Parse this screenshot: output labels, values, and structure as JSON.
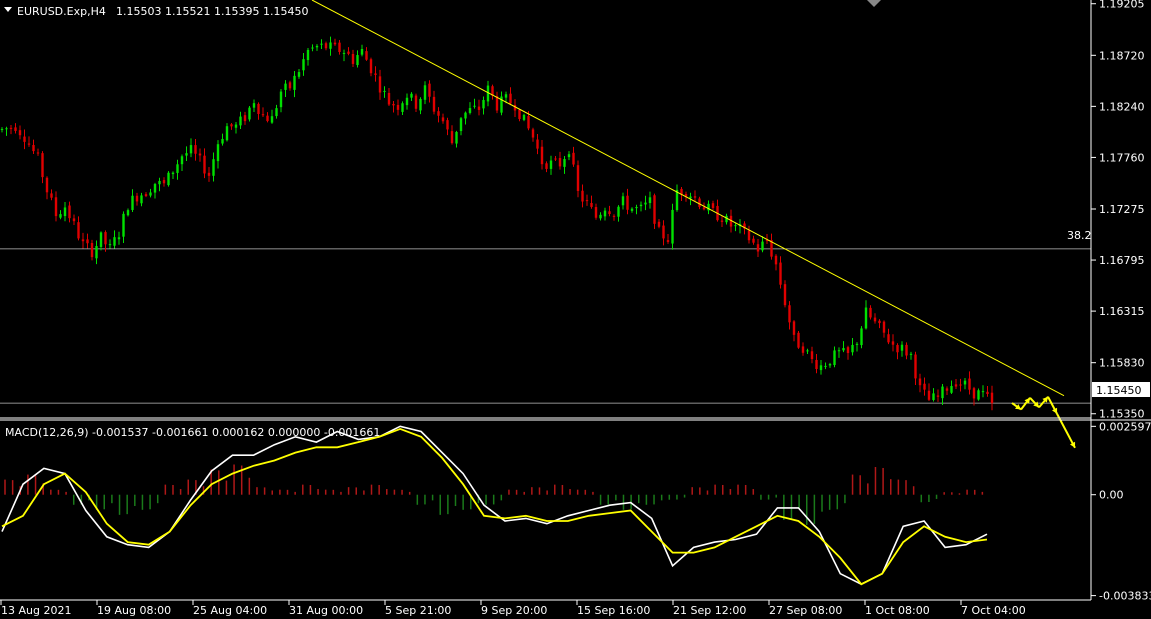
{
  "header": {
    "symbol": "EURUSD.Exp,H4",
    "ohlc": "1.15503 1.15521 1.15395 1.15450"
  },
  "indicator": {
    "label": "MACD(12,26,9) -0.001537 -0.001661 0.000162 0.000000 -0.001661"
  },
  "level_label": "38.2",
  "current_price": "1.15450",
  "colors": {
    "background": "#000000",
    "bull": "#00e000",
    "bear": "#e00000",
    "trendline": "#ffff00",
    "macd_line": "#ffffff",
    "signal_line": "#ffff00",
    "hist_pos": "#b01818",
    "hist_neg": "#1a7a1a",
    "grid_line": "#c0c0c0",
    "axis": "#ffffff"
  },
  "chart_data": [
    {
      "type": "candlestick",
      "title": "EURUSD.Exp,H4",
      "ylim": [
        1.1531,
        1.1924
      ],
      "y_ticks": [
        "1.19205",
        "1.18720",
        "1.18240",
        "1.17760",
        "1.17275",
        "1.16795",
        "1.16315",
        "1.15830",
        "1.15350"
      ],
      "x_ticks": [
        "13 Aug 2021",
        "19 Aug 08:00",
        "25 Aug 04:00",
        "31 Aug 00:00",
        "5 Sep 21:00",
        "9 Sep 20:00",
        "15 Sep 16:00",
        "21 Sep 12:00",
        "27 Sep 08:00",
        "1 Oct 08:00",
        "7 Oct 04:00"
      ],
      "path": [
        [
          0,
          1.1802
        ],
        [
          3,
          1.1806
        ],
        [
          5,
          1.1796
        ],
        [
          8,
          1.1774
        ],
        [
          10,
          1.1745
        ],
        [
          12,
          1.1722
        ],
        [
          14,
          1.173
        ],
        [
          16,
          1.1712
        ],
        [
          18,
          1.1694
        ],
        [
          20,
          1.1688
        ],
        [
          22,
          1.17
        ],
        [
          24,
          1.169
        ],
        [
          26,
          1.1705
        ],
        [
          28,
          1.1732
        ],
        [
          30,
          1.174
        ],
        [
          32,
          1.1744
        ],
        [
          34,
          1.1752
        ],
        [
          36,
          1.175
        ],
        [
          38,
          1.1764
        ],
        [
          40,
          1.1778
        ],
        [
          42,
          1.1782
        ],
        [
          44,
          1.1772
        ],
        [
          46,
          1.176
        ],
        [
          48,
          1.179
        ],
        [
          50,
          1.1805
        ],
        [
          52,
          1.1805
        ],
        [
          54,
          1.1814
        ],
        [
          56,
          1.183
        ],
        [
          58,
          1.1815
        ],
        [
          60,
          1.1812
        ],
        [
          62,
          1.1838
        ],
        [
          64,
          1.1842
        ],
        [
          66,
          1.1858
        ],
        [
          68,
          1.1876
        ],
        [
          70,
          1.188
        ],
        [
          72,
          1.188
        ],
        [
          74,
          1.1878
        ],
        [
          76,
          1.1876
        ],
        [
          78,
          1.1868
        ],
        [
          80,
          1.1876
        ],
        [
          82,
          1.186
        ],
        [
          84,
          1.1843
        ],
        [
          86,
          1.1828
        ],
        [
          88,
          1.1825
        ],
        [
          90,
          1.1835
        ],
        [
          92,
          1.1826
        ],
        [
          94,
          1.184
        ],
        [
          96,
          1.1822
        ],
        [
          98,
          1.181
        ],
        [
          100,
          1.179
        ],
        [
          102,
          1.1815
        ],
        [
          104,
          1.182
        ],
        [
          106,
          1.1822
        ],
        [
          108,
          1.184
        ],
        [
          110,
          1.1825
        ],
        [
          112,
          1.183
        ],
        [
          114,
          1.1826
        ],
        [
          116,
          1.181
        ],
        [
          118,
          1.1795
        ],
        [
          120,
          1.1772
        ],
        [
          122,
          1.177
        ],
        [
          124,
          1.177
        ],
        [
          126,
          1.1785
        ],
        [
          128,
          1.1742
        ],
        [
          130,
          1.1732
        ],
        [
          132,
          1.172
        ],
        [
          134,
          1.173
        ],
        [
          136,
          1.1725
        ],
        [
          138,
          1.1734
        ],
        [
          140,
          1.1728
        ],
        [
          142,
          1.1727
        ],
        [
          144,
          1.1734
        ],
        [
          146,
          1.1705
        ],
        [
          148,
          1.17
        ],
        [
          150,
          1.1745
        ],
        [
          152,
          1.1745
        ],
        [
          154,
          1.1738
        ],
        [
          156,
          1.173
        ],
        [
          158,
          1.1724
        ],
        [
          160,
          1.172
        ],
        [
          162,
          1.1712
        ],
        [
          164,
          1.1708
        ],
        [
          166,
          1.17
        ],
        [
          168,
          1.169
        ],
        [
          170,
          1.1698
        ],
        [
          172,
          1.1675
        ],
        [
          174,
          1.164
        ],
        [
          176,
          1.1604
        ],
        [
          178,
          1.1598
        ],
        [
          180,
          1.1585
        ],
        [
          182,
          1.158
        ],
        [
          184,
          1.1586
        ],
        [
          186,
          1.1592
        ],
        [
          188,
          1.159
        ],
        [
          190,
          1.1604
        ],
        [
          192,
          1.163
        ],
        [
          194,
          1.162
        ],
        [
          196,
          1.161
        ],
        [
          198,
          1.16
        ],
        [
          200,
          1.1596
        ],
        [
          202,
          1.159
        ],
        [
          204,
          1.1558
        ],
        [
          206,
          1.1548
        ],
        [
          208,
          1.155
        ],
        [
          210,
          1.156
        ],
        [
          212,
          1.1566
        ],
        [
          214,
          1.1562
        ],
        [
          216,
          1.1555
        ],
        [
          218,
          1.1553
        ],
        [
          220,
          1.1545
        ]
      ],
      "levels": [
        1.169,
        1.1545
      ],
      "trendline": [
        [
          -20,
          1.1924
        ],
        [
          236,
          1.1552
        ]
      ],
      "projection": [
        [
          220,
          1.1545
        ],
        [
          222,
          1.1539
        ],
        [
          224,
          1.155
        ],
        [
          226,
          1.1541
        ],
        [
          228,
          1.1551
        ],
        [
          230,
          1.1535
        ],
        [
          234,
          1.1503
        ]
      ]
    },
    {
      "type": "macd",
      "title": "MACD(12,26,9)",
      "ylim": [
        -0.004,
        0.0028
      ],
      "y_ticks": [
        "0.002597",
        "0.00",
        "-0.003833"
      ],
      "params": [
        12,
        26,
        9
      ],
      "macd": [
        -0.0014,
        0.0004,
        0.001,
        0.0008,
        -0.0006,
        -0.0016,
        -0.0019,
        -0.002,
        -0.0014,
        -0.0002,
        0.0009,
        0.0015,
        0.0015,
        0.0019,
        0.0022,
        0.002,
        0.0024,
        0.0021,
        0.0022,
        0.0026,
        0.0024,
        0.0016,
        0.0008,
        -0.0004,
        -0.001,
        -0.0009,
        -0.0011,
        -0.0008,
        -0.0006,
        -0.0004,
        -0.0003,
        -0.0009,
        -0.0027,
        -0.002,
        -0.0018,
        -0.0017,
        -0.0015,
        -0.0005,
        -0.0005,
        -0.0014,
        -0.003,
        -0.0034,
        -0.003,
        -0.0012,
        -0.001,
        -0.002,
        -0.0019,
        -0.0015
      ],
      "signal": [
        -0.0012,
        -0.0008,
        0.0004,
        0.0008,
        0.0001,
        -0.0011,
        -0.0018,
        -0.0019,
        -0.0014,
        -0.0004,
        0.0004,
        0.0008,
        0.0011,
        0.0013,
        0.0016,
        0.0018,
        0.0018,
        0.002,
        0.0022,
        0.0025,
        0.0022,
        0.0014,
        0.0004,
        -0.0008,
        -0.0009,
        -0.0008,
        -0.001,
        -0.001,
        -0.0008,
        -0.0007,
        -0.0006,
        -0.0014,
        -0.0022,
        -0.0022,
        -0.002,
        -0.0016,
        -0.0012,
        -0.0008,
        -0.001,
        -0.0016,
        -0.0024,
        -0.0034,
        -0.003,
        -0.0018,
        -0.0012,
        -0.0016,
        -0.0018,
        -0.0017
      ],
      "histogram": [
        0.0006,
        0.0008,
        0.0002,
        -0.0004,
        -0.0006,
        -0.0008,
        -0.0006,
        0.0004,
        0.0006,
        0.001,
        0.0012,
        0.0003,
        0.0002,
        0.0004,
        0.0002,
        0.0003,
        0.0004,
        0.0002,
        -0.0004,
        -0.0008,
        -0.0006,
        -0.0004,
        0.0002,
        0.0003,
        0.0004,
        0.0002,
        -0.0004,
        -0.0006,
        -0.0004,
        -0.0002,
        0.0003,
        0.0004,
        0.0004,
        -0.0002,
        -0.001,
        -0.0012,
        -0.0006,
        0.0008,
        0.0011,
        0.0006,
        -0.0003,
        0.0001,
        0.0002
      ]
    }
  ]
}
